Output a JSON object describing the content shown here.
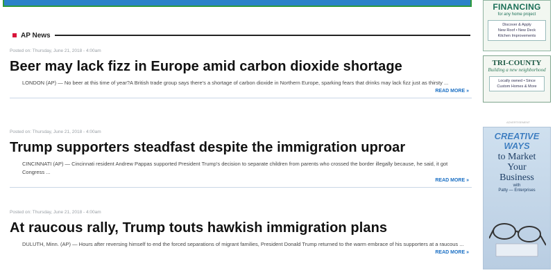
{
  "section": {
    "title": "AP News"
  },
  "articles": [
    {
      "posted": "Posted on: Thursday, June 21, 2018 - 4:00am",
      "headline": "Beer may lack fizz in Europe amid carbon dioxide shortage",
      "summary": "LONDON (AP) — No beer at this time of year?A British trade group says there's a shortage of carbon dioxide in Northern Europe, sparking fears that drinks may lack fizz just as thirsty ...",
      "read_more": "READ MORE »"
    },
    {
      "posted": "Posted on: Thursday, June 21, 2018 - 4:00am",
      "headline": "Trump supporters steadfast despite the immigration uproar",
      "summary": "CINCINNATI (AP) — Cincinnati resident Andrew Pappas supported President Trump's decision to separate children from parents who crossed the border illegally because, he said, it got Congress ...",
      "read_more": "READ MORE »"
    },
    {
      "posted": "Posted on: Thursday, June 21, 2018 - 4:00am",
      "headline": "At raucous rally, Trump touts hawkish immigration plans",
      "summary": "DULUTH, Minn. (AP) — Hours after reversing himself to end the forced separations of migrant families, President Donald Trump returned to the warm embrace of his supporters at a raucous ...",
      "read_more": "READ MORE »"
    }
  ],
  "ads": {
    "financing": {
      "big": "FINANCING",
      "small": "for any home project",
      "box": "Discover & Apply\nNew Roof • New Deck\nKitchen Improvements"
    },
    "tricounty": {
      "big": "TRI-COUNTY",
      "tag": "Building a new neighborhood",
      "box": "Locally owned • Since\nCustom Homes & More"
    },
    "label": "ADVERTISEMENT",
    "creative": {
      "big1": "CREATIVE",
      "big2": "WAYS",
      "script1": "to Market",
      "script2": "Your",
      "script3": "Business",
      "with": "with",
      "name": "Patty — Enterprises"
    }
  },
  "colors": {
    "accent_red": "#d8143a",
    "link_blue": "#1a6fc4",
    "banner_blue": "#2a82c9",
    "banner_green": "#2e9a3b"
  }
}
